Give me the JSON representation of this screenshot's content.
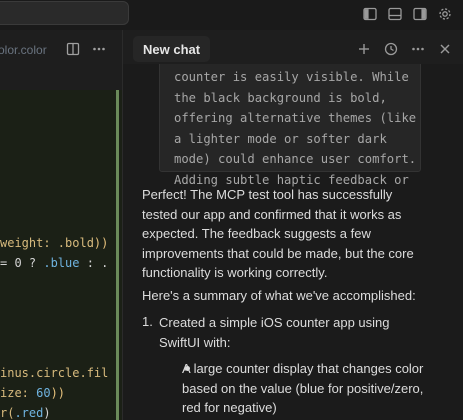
{
  "window": {
    "icons": [
      "sidebar-left-icon",
      "panel-bottom-icon",
      "sidebar-right-icon",
      "settings-gear-icon"
    ]
  },
  "editor": {
    "tab_name": "olor.color",
    "icons": [
      "split-editor-icon",
      "more-icon"
    ],
    "code": {
      "l1a": "weight: .bold",
      "l1b": "))",
      "l2a": "= 0 ? ",
      "l2b": ".blue",
      "l2c": " : .",
      "l3a": "inus.circle.fil",
      "l4a": "ize: ",
      "l4b": "60",
      "l4c": "))",
      "l5a": "r(",
      "l5b": ".red",
      "l5c": ")"
    }
  },
  "chat": {
    "tab_label": "New chat",
    "actions": [
      "add-icon",
      "history-icon",
      "more-icon",
      "close-icon"
    ],
    "quote_lines": [
      "counter is easily visible. While",
      "the black background is bold,",
      "offering alternative themes (like",
      "a lighter mode or softer dark",
      "mode) could enhance user comfort.",
      "Adding subtle haptic feedback or"
    ],
    "para1": [
      "Perfect! The MCP test tool has successfully",
      "tested our app and confirmed that it works as",
      "expected. The feedback suggests a few",
      "improvements that could be made, but the core",
      "functionality is working correctly."
    ],
    "para2": "Here's a summary of what we've accomplished:",
    "list_number": "1.",
    "list_item": [
      "Created a simple iOS counter app using",
      "SwiftUI with:"
    ],
    "sub_item": [
      "A large counter display that changes color",
      "based on the value (blue for positive/zero,",
      "red for negative)"
    ]
  }
}
